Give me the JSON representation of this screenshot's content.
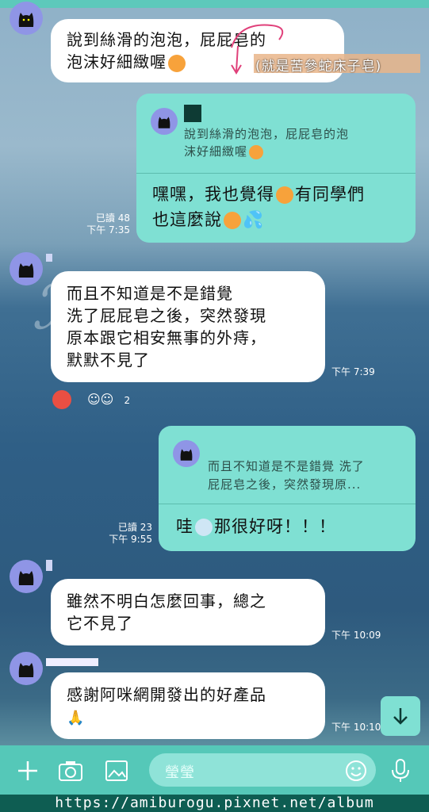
{
  "messages": {
    "m1": {
      "line1": "說到絲滑的泡泡，屁屁皂的",
      "line2": "泡沫好細緻喔",
      "annotation": "(就是苦參蛇床子皂)"
    },
    "r1": {
      "quote_line1": "說到絲滑的泡泡，屁屁皂的泡",
      "quote_line2": "沫好細緻喔",
      "line1": "嘿嘿，我也覺得",
      "line1b": "有同學們",
      "line2": "也這麼說",
      "read": "已讀 48",
      "time": "下午 7:35"
    },
    "m2": {
      "line1": "而且不知道是不是錯覺",
      "line2": "洗了屁屁皂之後，突然發現",
      "line3": "原本跟它相安無事的外痔，",
      "line4": "默默不見了",
      "time": "下午 7:39",
      "reaction_count": "2"
    },
    "r2": {
      "quote_line1": "而且不知道是不是錯覺 洗了",
      "quote_line2": "屁屁皂之後，突然發現原...",
      "line1": "哇",
      "line1b": "那很好呀！！！",
      "read": "已讀 23",
      "time": "下午 9:55"
    },
    "m3": {
      "line1": "雖然不明白怎麼回事，總之",
      "line2": "它不見了",
      "time": "下午 10:09"
    },
    "m4": {
      "line1": "感謝阿咪網開發出的好產品",
      "time": "下午 10:10"
    }
  },
  "input": {
    "placeholder": "瑩瑩"
  },
  "footer": {
    "url": "https://amiburogu.pixnet.net/album"
  },
  "colors": {
    "accent": "#55c8b8",
    "bubble_right": "#7fe0d3",
    "bubble_left": "#ffffff",
    "avatar": "#8f95e6"
  }
}
